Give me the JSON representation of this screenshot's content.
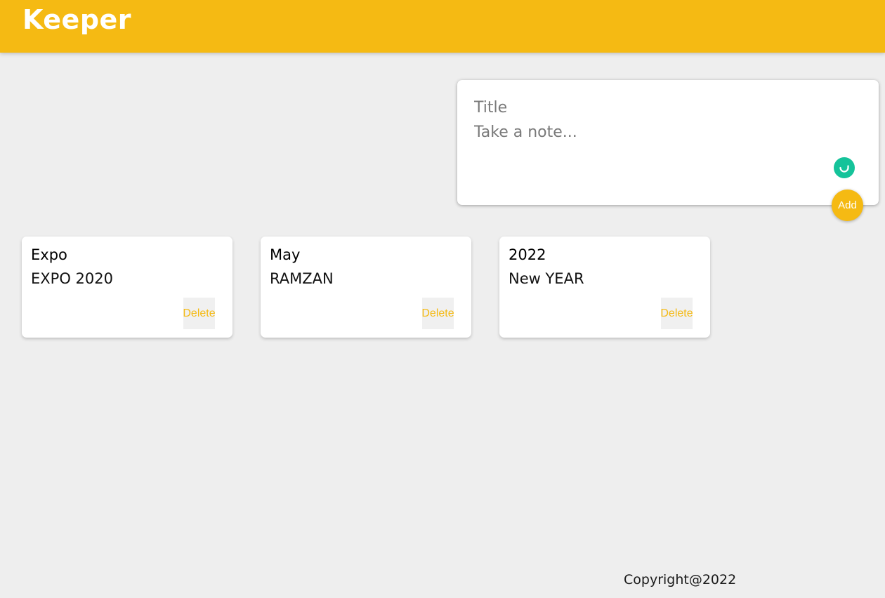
{
  "header": {
    "title": "Keeper"
  },
  "create_area": {
    "title_placeholder": "Title",
    "content_placeholder": "Take a note...",
    "add_label": "Add",
    "assistant_icon": "grammarly-icon"
  },
  "notes": [
    {
      "title": "Expo",
      "content": "EXPO 2020",
      "delete_label": "Delete"
    },
    {
      "title": "May",
      "content": "RAMZAN",
      "delete_label": "Delete"
    },
    {
      "title": "2022",
      "content": "New YEAR",
      "delete_label": "Delete"
    }
  ],
  "footer": {
    "text": "Copyright@2022"
  },
  "colors": {
    "accent": "#f5ba13",
    "background": "#eeeeee",
    "assistant": "#15c39a"
  }
}
